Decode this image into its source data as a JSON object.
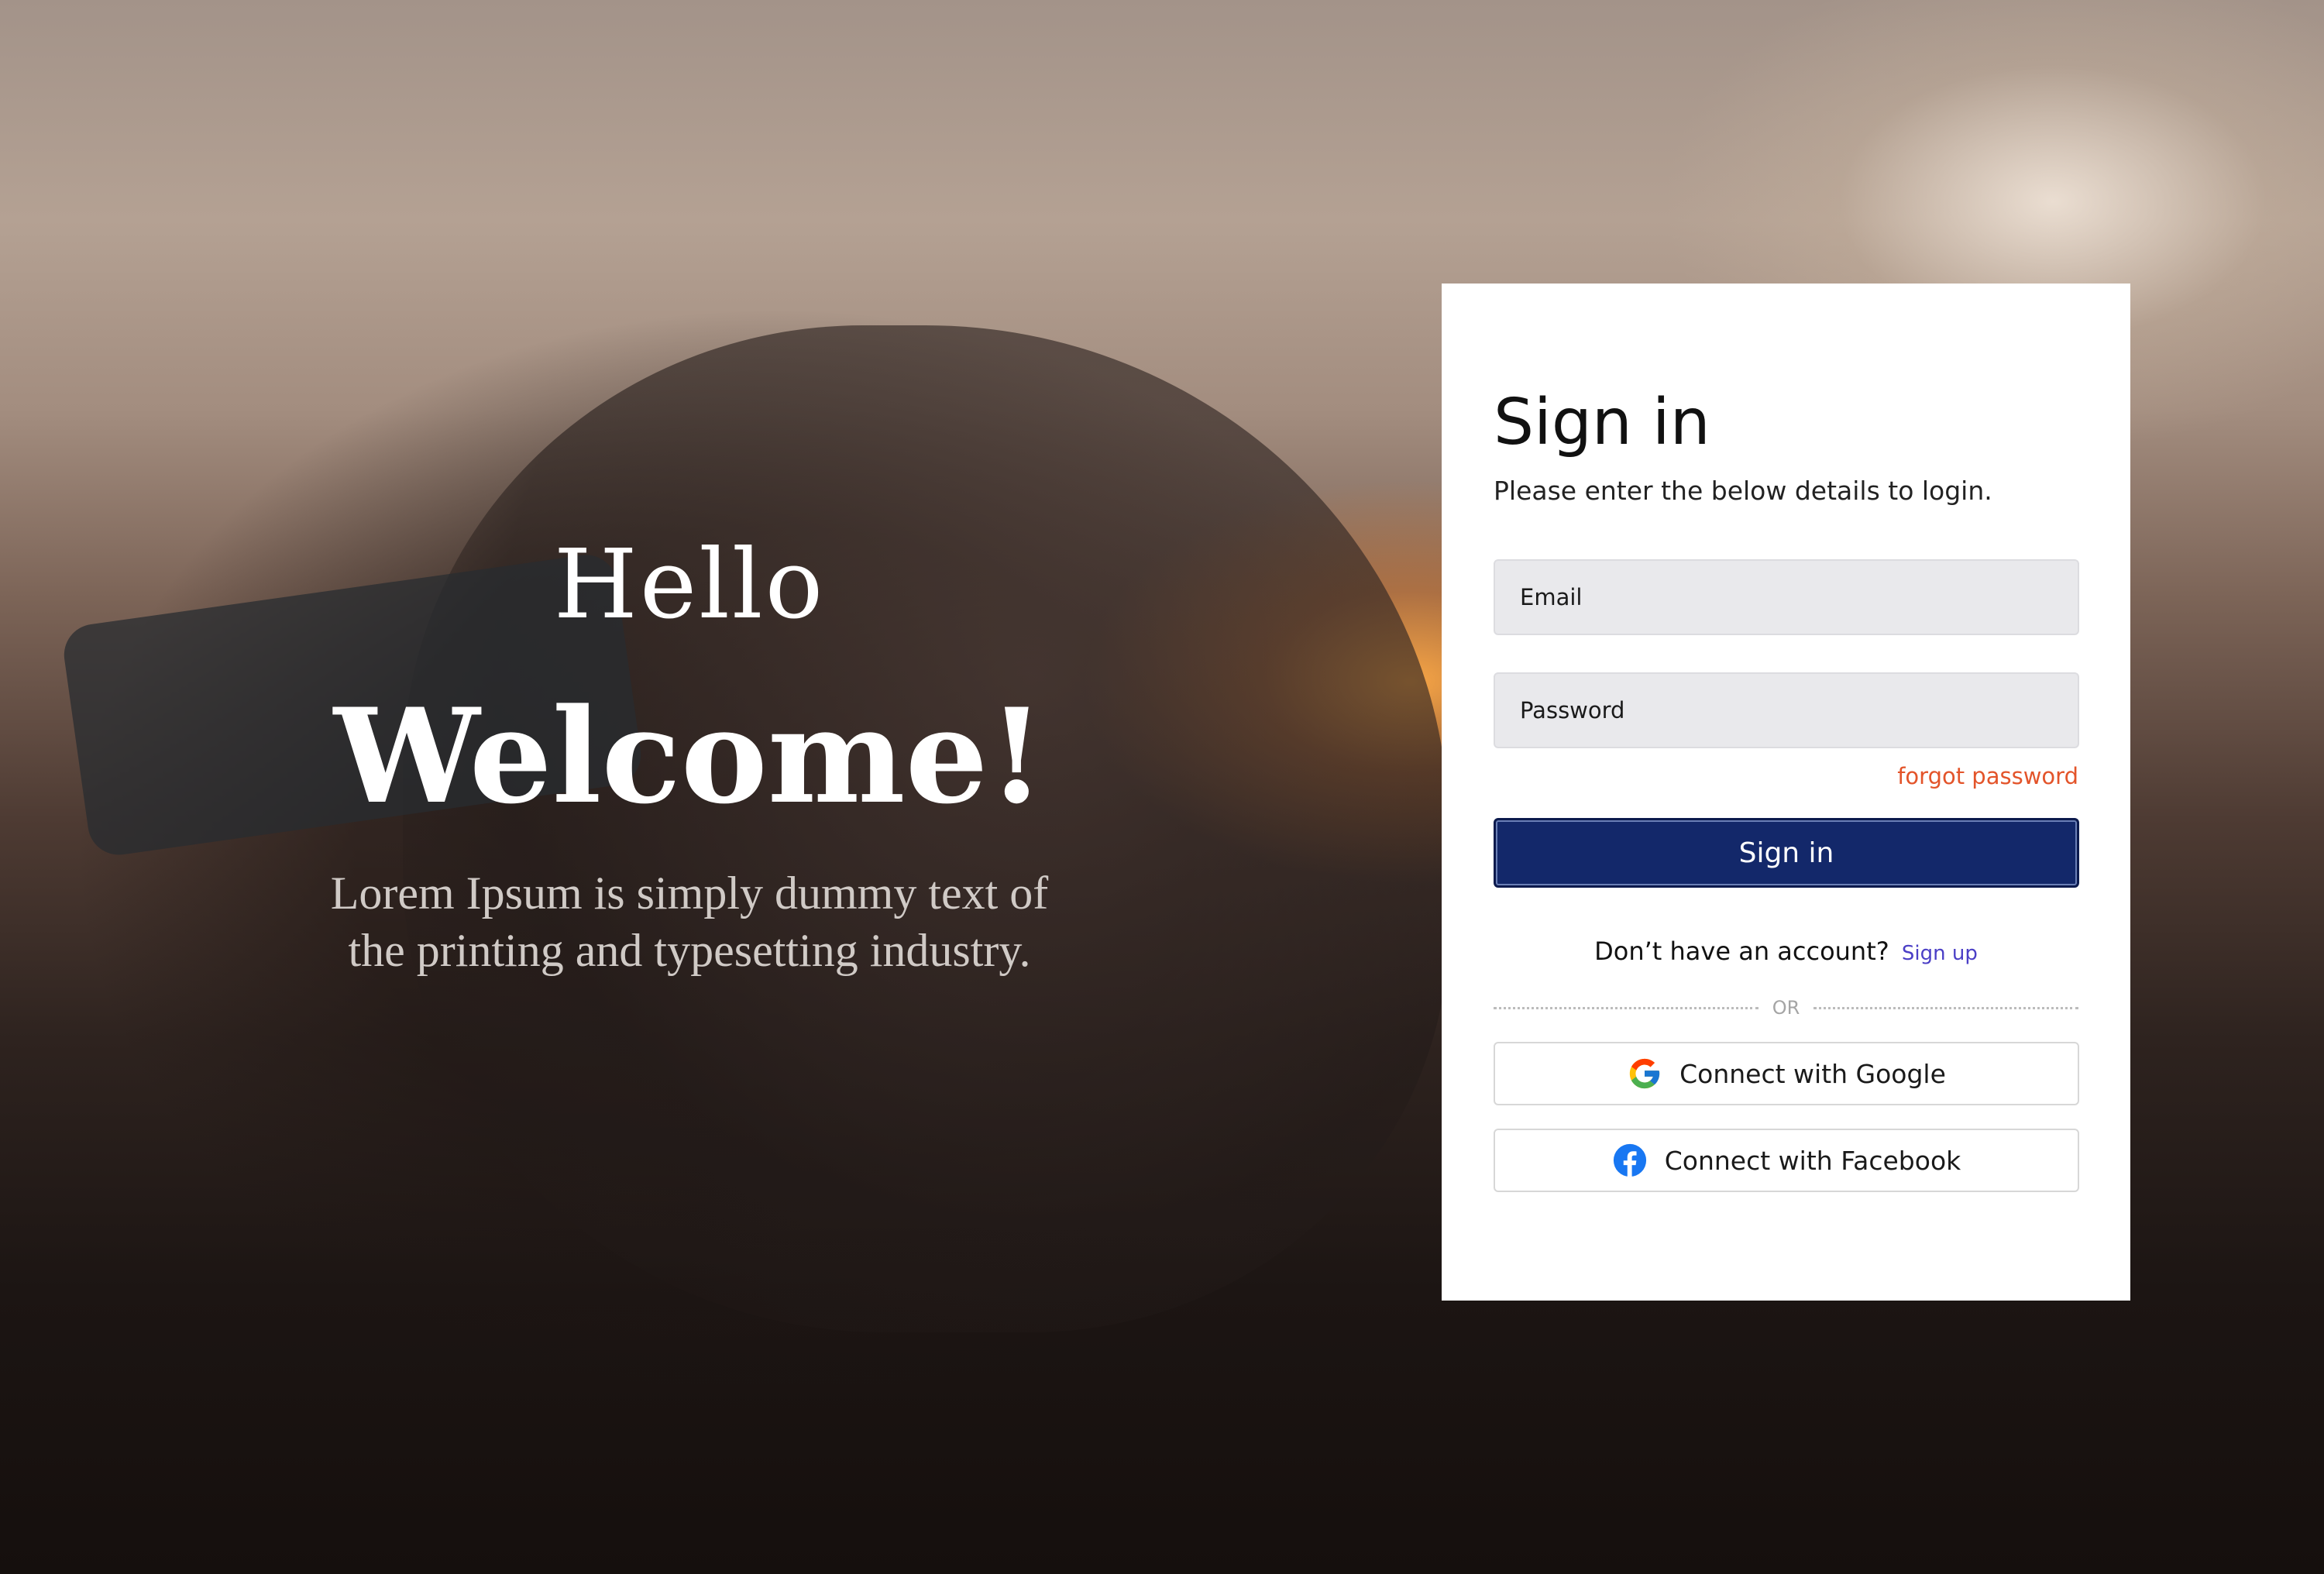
{
  "hero": {
    "greeting": "Hello",
    "headline": "Welcome!",
    "tagline": "Lorem Ipsum is simply dummy text of the printing and typesetting industry."
  },
  "login": {
    "title": "Sign in",
    "subtitle": "Please enter the below details to login.",
    "email_placeholder": "Email",
    "password_placeholder": "Password",
    "forgot_label": "forgot password",
    "submit_label": "Sign in",
    "signup_prompt": "Don’t have an account?",
    "signup_link": "Sign up",
    "divider_label": "OR",
    "google_label": "Connect with Google",
    "facebook_label": "Connect with Facebook"
  },
  "colors": {
    "primary": "#13286a",
    "forgot": "#e3542a",
    "signup_link": "#4b3fc6",
    "facebook": "#1877f2"
  },
  "icons": {
    "google": "google-icon",
    "facebook": "facebook-icon"
  }
}
